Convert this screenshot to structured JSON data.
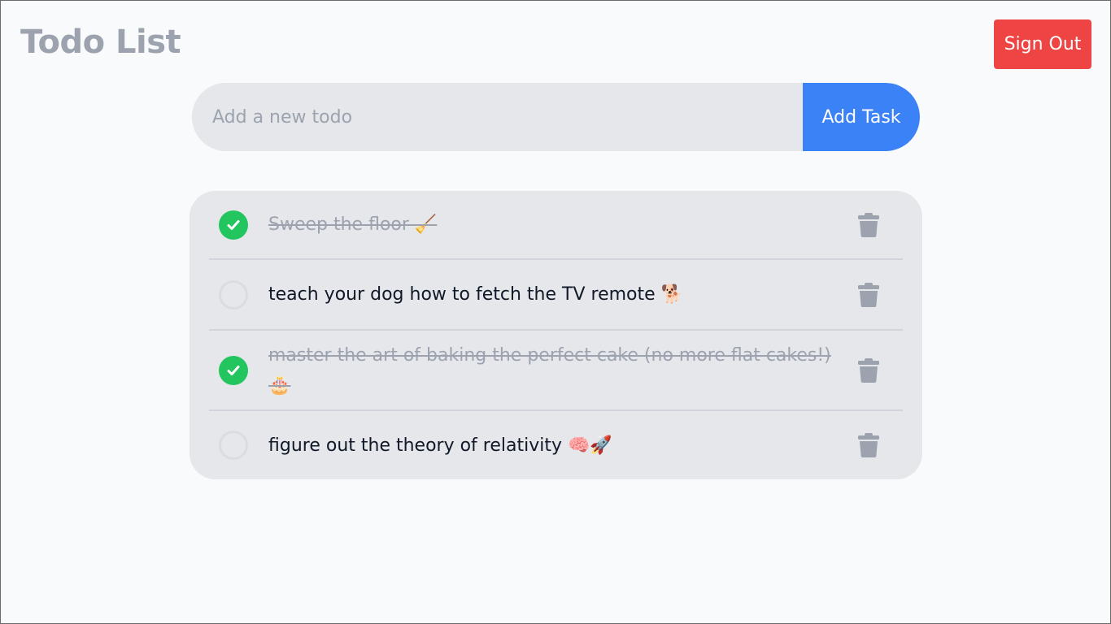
{
  "header": {
    "title": "Todo List",
    "sign_out_label": "Sign Out"
  },
  "add_form": {
    "placeholder": "Add a new todo",
    "value": "",
    "button_label": "Add Task"
  },
  "todos": [
    {
      "text": "Sweep the floor 🧹",
      "completed": true
    },
    {
      "text": "teach your dog how to fetch the TV remote 🐕",
      "completed": false
    },
    {
      "text": "master the art of baking the perfect cake (no more flat cakes!) 🎂",
      "completed": true
    },
    {
      "text": "figure out the theory of relativity 🧠🚀",
      "completed": false
    }
  ],
  "icons": {
    "check": "check-icon",
    "delete": "trash-icon"
  },
  "colors": {
    "title": "#9ca3af",
    "sign_out": "#ef4444",
    "add_button": "#3b82f6",
    "completed": "#22c55e",
    "list_bg": "#e5e7eb",
    "page_bg": "#f9fafb",
    "trash": "#9ca3af"
  }
}
